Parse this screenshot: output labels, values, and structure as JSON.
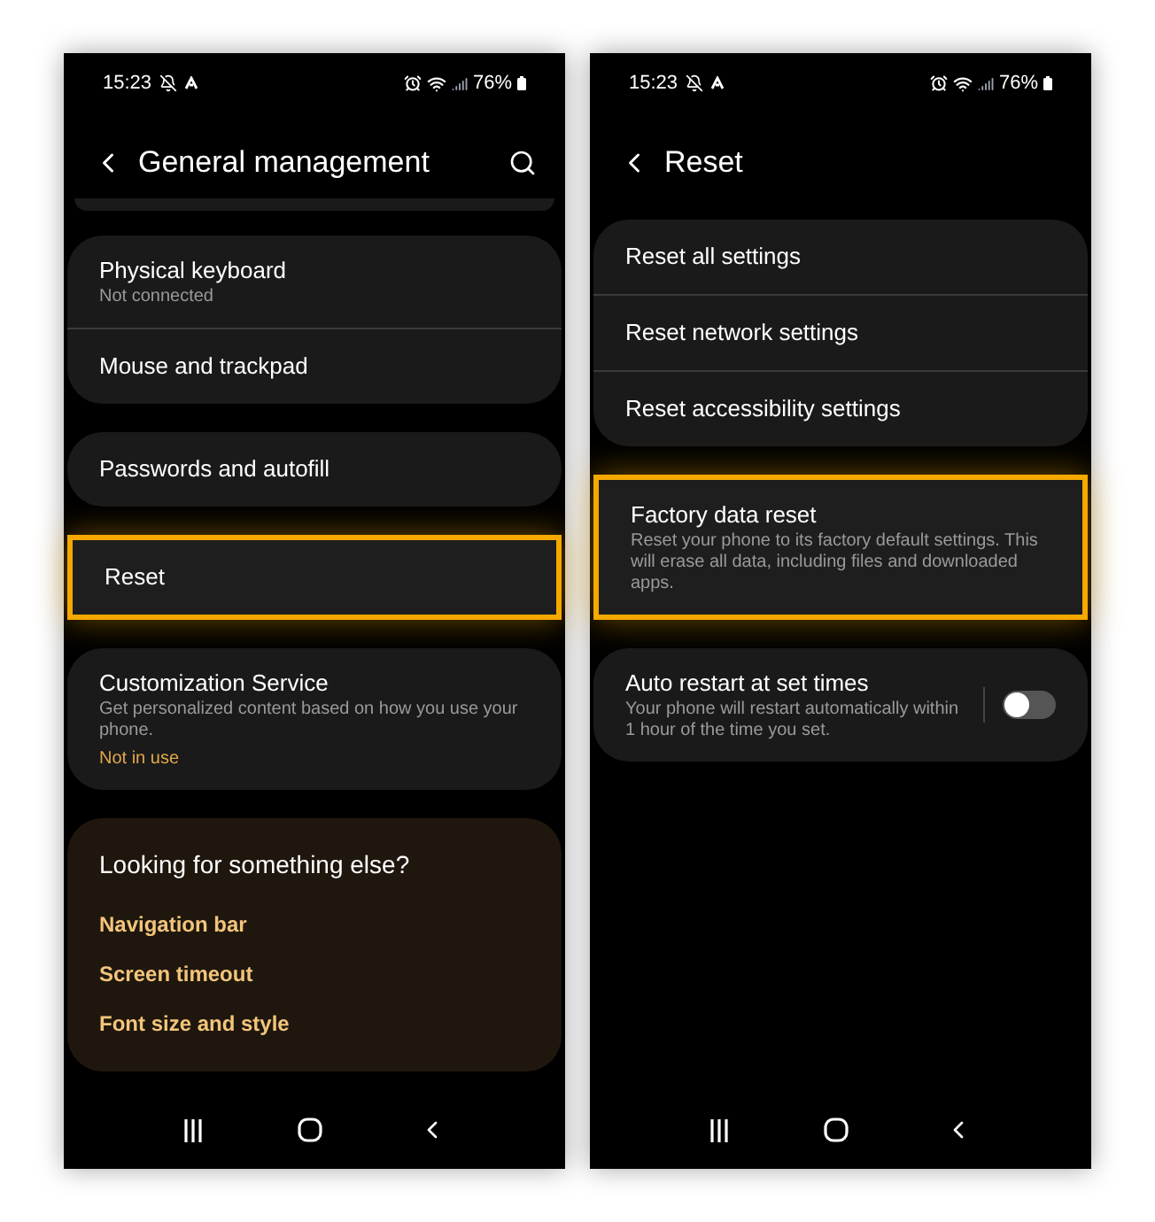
{
  "screens": [
    {
      "status_bar": {
        "time": "15:23",
        "battery": "76%"
      },
      "title": "General management",
      "search": true,
      "top_sliver": true,
      "groups": [
        {
          "items": [
            {
              "kind": "row",
              "title": "Physical keyboard",
              "subtitle": "Not connected",
              "highlighted": false
            },
            {
              "kind": "row",
              "title": "Mouse and trackpad",
              "highlighted": false
            }
          ]
        },
        {
          "items": [
            {
              "kind": "row",
              "title": "Passwords and autofill",
              "highlighted": false
            }
          ]
        },
        {
          "items": [
            {
              "kind": "row",
              "title": "Reset",
              "highlighted": true
            }
          ]
        },
        {
          "items": [
            {
              "kind": "row",
              "title": "Customization Service",
              "subtitle": "Get personalized content based on how you use your phone.",
              "status": "Not in use",
              "highlighted": false
            }
          ]
        }
      ],
      "suggestions": {
        "heading": "Looking for something else?",
        "links": [
          "Navigation bar",
          "Screen timeout",
          "Font size and style"
        ]
      }
    },
    {
      "status_bar": {
        "time": "15:23",
        "battery": "76%"
      },
      "title": "Reset",
      "search": false,
      "top_sliver": false,
      "groups": [
        {
          "items": [
            {
              "kind": "row",
              "title": "Reset all settings",
              "highlighted": false
            },
            {
              "kind": "row",
              "title": "Reset network settings",
              "highlighted": false
            },
            {
              "kind": "row",
              "title": "Reset accessibility settings",
              "highlighted": false
            }
          ]
        },
        {
          "items": [
            {
              "kind": "row",
              "title": "Factory data reset",
              "subtitle": "Reset your phone to its factory default settings. This will erase all data, including files and downloaded apps.",
              "highlighted": true
            }
          ]
        },
        {
          "items": [
            {
              "kind": "toggle",
              "title": "Auto restart at set times",
              "subtitle": "Your phone will restart automatically within 1 hour of the time you set.",
              "on": false,
              "highlighted": false
            }
          ]
        }
      ]
    }
  ]
}
